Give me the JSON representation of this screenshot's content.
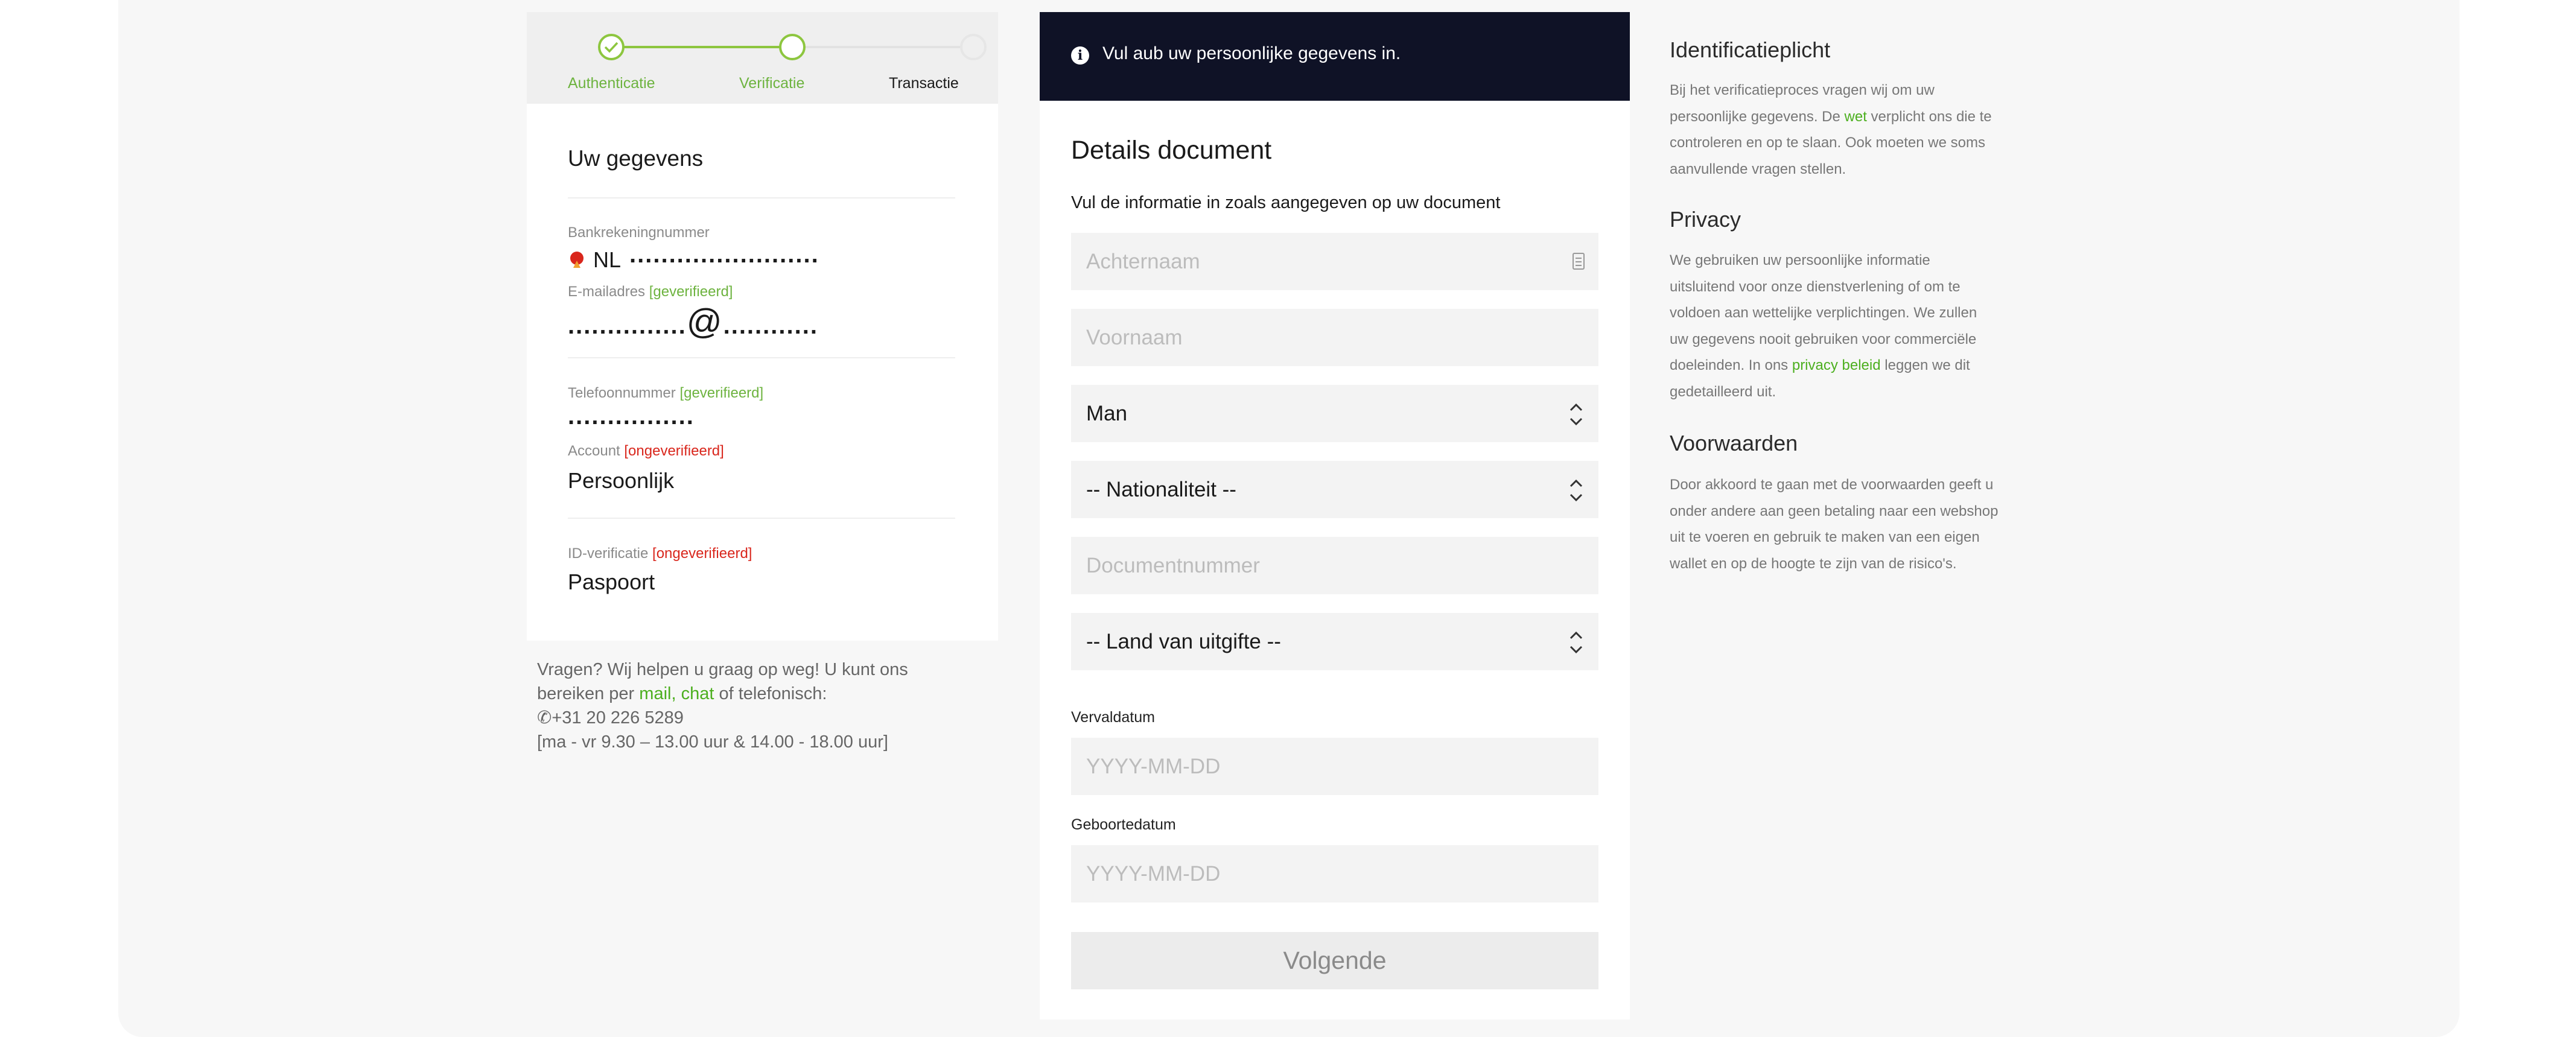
{
  "steps": [
    {
      "label": "Authenticatie",
      "state": "done"
    },
    {
      "label": "Verificatie",
      "state": "active"
    },
    {
      "label": "Transactie",
      "state": "pending"
    }
  ],
  "colors": {
    "accent": "#8dc63f",
    "link": "#4caf1f",
    "error": "#d9261c",
    "banner": "#0f1226"
  },
  "summary": {
    "title": "Uw gegevens",
    "iban_label": "Bankrekeningnummer",
    "iban_prefix": "NL",
    "iban_mask": "........................",
    "email_label": "E-mailadres",
    "email_status": "[geverifieerd]",
    "email_mask_left": "...............",
    "email_at": "@",
    "email_mask_right": "............",
    "phone_label": "Telefoonnummer",
    "phone_status": "[geverifieerd]",
    "phone_mask": "................",
    "account_label": "Account",
    "account_status": "[ongeverifieerd]",
    "account_value": "Persoonlijk",
    "idv_label": "ID-verificatie",
    "idv_status": "[ongeverifieerd]",
    "idv_value": "Paspoort"
  },
  "help": {
    "line1": "Vragen? Wij helpen u graag op weg! U kunt ons",
    "line2_a": "bereiken per",
    "mail": "mail",
    "comma": ",",
    "chat": "chat",
    "line2_b": "of telefonisch:",
    "phone": "+31 20 226 5289",
    "hours": "[ma - vr 9.30 – 13.00 uur & 14.00 - 18.00 uur]"
  },
  "banner": {
    "icon": "info-icon",
    "text": "Vul aub uw persoonlijke gegevens in."
  },
  "form": {
    "title": "Details document",
    "subtitle": "Vul de informatie in zoals aangegeven op uw document",
    "lastname_placeholder": "Achternaam",
    "firstname_placeholder": "Voornaam",
    "gender_value": "Man",
    "nationality_value": "-- Nationaliteit --",
    "docnumber_placeholder": "Documentnummer",
    "country_value": "-- Land van uitgifte --",
    "expiry_label": "Vervaldatum",
    "expiry_placeholder": "YYYY-MM-DD",
    "birth_label": "Geboortedatum",
    "birth_placeholder": "YYYY-MM-DD",
    "next_button": "Volgende"
  },
  "info": {
    "id_title": "Identificatieplicht",
    "id_p1": "Bij het verificatieproces vragen wij om uw",
    "id_p2a": "persoonlijke gegevens. De",
    "id_link": "wet",
    "id_p2b": "verplicht ons die te",
    "id_p3": "controleren en op te slaan. Ook moeten we soms",
    "id_p4": "aanvullende vragen stellen.",
    "privacy_title": "Privacy",
    "privacy_p1": "We gebruiken uw persoonlijke informatie",
    "privacy_p2": "uitsluitend voor onze dienstverlening of om te",
    "privacy_p3": "voldoen aan wettelijke verplichtingen. We zullen",
    "privacy_p4": "uw gegevens nooit gebruiken voor commerciële",
    "privacy_p5a": "doeleinden. In ons",
    "privacy_link": "privacy beleid",
    "privacy_p5b": "leggen we dit",
    "privacy_p6": "gedetailleerd uit.",
    "terms_title": "Voorwaarden",
    "terms_p1": "Door akkoord te gaan met de voorwaarden geeft u",
    "terms_p2": "onder andere aan geen betaling naar een webshop",
    "terms_p3": "uit te voeren en gebruik te maken van een eigen",
    "terms_p4": "wallet en op de hoogte te zijn van de risico's."
  }
}
